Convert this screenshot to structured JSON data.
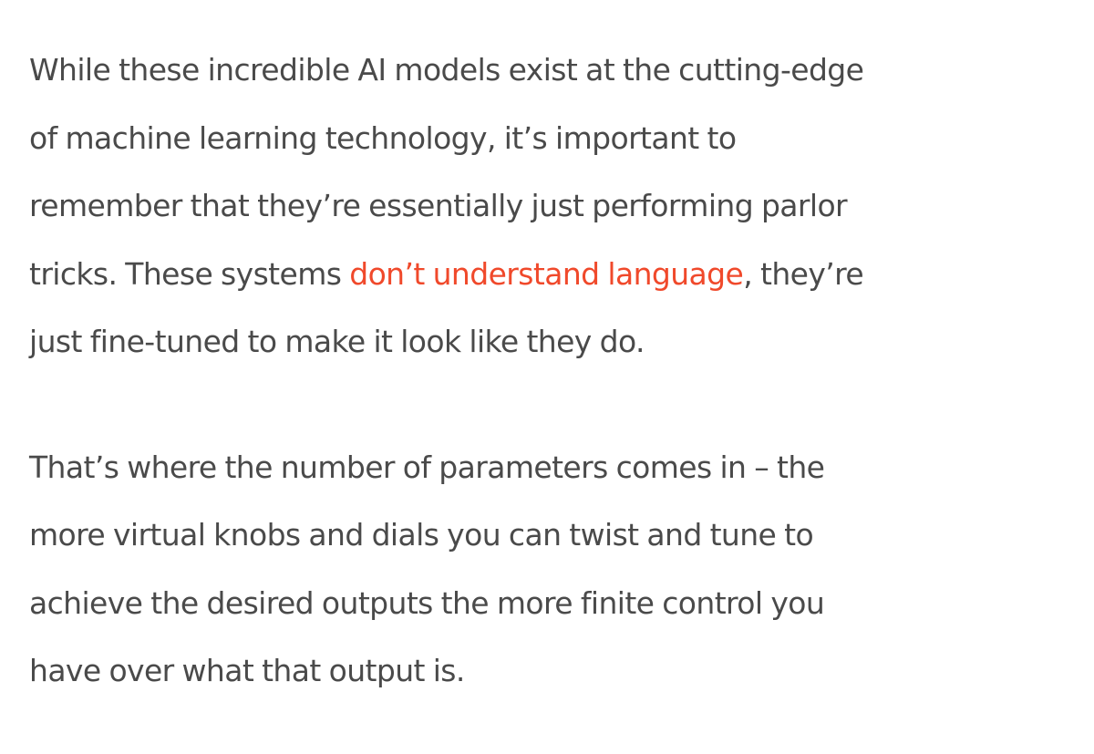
{
  "article": {
    "paragraph_1": {
      "line_1": "While these incredible AI models exist at the cutting-edge",
      "line_2": "of machine learning technology, it’s important to",
      "line_3": "remember that they’re essentially just performing parlor",
      "line_4_before_link": "tricks. These systems ",
      "link_text": "don’t understand language",
      "line_4_after_link": ", they’re",
      "line_5": "just fine-tuned to make it look like they do."
    },
    "paragraph_2": {
      "line_1": "That’s where the number of parameters comes in – the",
      "line_2": "more virtual knobs and dials you can twist and tune to",
      "line_3": "achieve the desired outputs the more finite control you",
      "line_4": "have over what that output is."
    }
  },
  "colors": {
    "text": "#4a4a4a",
    "link": "#f0492b",
    "background": "#ffffff"
  }
}
